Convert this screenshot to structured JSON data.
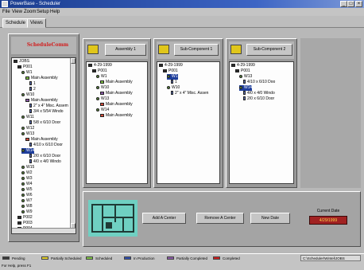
{
  "window": {
    "title": "PowerBase - Scheduler",
    "controls": [
      "_",
      "□",
      "×"
    ],
    "menu": [
      "File",
      "View",
      "Zoom",
      "Setup",
      "Help"
    ]
  },
  "tabs": [
    "Schedule",
    "Views"
  ],
  "panels": {
    "jobs": {
      "logo_text": "ScheduleComm",
      "tree": [
        {
          "text": "JOBS",
          "icon": "folder-icon"
        },
        {
          "text": "P001",
          "icon": "folder-icon"
        },
        {
          "text": "W1",
          "icon": "gear-icon"
        },
        {
          "text": "Main Assembly",
          "icon": "tag-green-icon"
        },
        {
          "text": "1",
          "icon": "doc-icon"
        },
        {
          "text": "2",
          "icon": "doc-icon"
        },
        {
          "text": "W10",
          "icon": "gear-icon"
        },
        {
          "text": "Main Assembly",
          "icon": "tag-purple-icon"
        },
        {
          "text": "2\" x 4\" Misc. Assem",
          "icon": "doc-icon"
        },
        {
          "text": "3/4 x 5/54 Windo",
          "icon": "doc-icon"
        },
        {
          "text": "W11",
          "icon": "gear-icon"
        },
        {
          "text": "5/8 x 6/10 Door",
          "icon": "doc-icon"
        },
        {
          "text": "W12",
          "icon": "gear-icon"
        },
        {
          "text": "W13",
          "icon": "gear-icon"
        },
        {
          "text": "Main Assembly",
          "icon": "tag-red-icon"
        },
        {
          "text": "4/10 x 6/10 Door",
          "icon": "doc-icon"
        },
        {
          "text": "W14",
          "icon": "gear-icon",
          "selected": true
        },
        {
          "text": "2/0 x 6/10 Door",
          "icon": "doc-icon"
        },
        {
          "text": "4/0 x 4/0 Windo",
          "icon": "doc-icon"
        },
        {
          "text": "W15",
          "icon": "gear-icon"
        },
        {
          "text": "W2",
          "icon": "gear-icon"
        },
        {
          "text": "W3",
          "icon": "gear-icon"
        },
        {
          "text": "W4",
          "icon": "gear-icon"
        },
        {
          "text": "W5",
          "icon": "gear-icon"
        },
        {
          "text": "W6",
          "icon": "gear-icon"
        },
        {
          "text": "W7",
          "icon": "gear-icon"
        },
        {
          "text": "W8",
          "icon": "gear-icon"
        },
        {
          "text": "W9",
          "icon": "gear-icon"
        },
        {
          "text": "P002",
          "icon": "folder-icon"
        },
        {
          "text": "P003",
          "icon": "folder-icon"
        },
        {
          "text": "P004",
          "icon": "folder-icon"
        }
      ]
    },
    "assembly": {
      "button_label": "Assembly 1",
      "tree": [
        {
          "text": "4-29-1999",
          "icon": "folder-icon"
        },
        {
          "text": "P001",
          "icon": "folder-icon"
        },
        {
          "text": "W1",
          "icon": "gear-icon"
        },
        {
          "text": "Main Assembly",
          "icon": "tag-green-icon"
        },
        {
          "text": "W10",
          "icon": "gear-icon"
        },
        {
          "text": "Main Assembly",
          "icon": "tag-purple-icon"
        },
        {
          "text": "W13",
          "icon": "gear-icon"
        },
        {
          "text": "Main Assembly",
          "icon": "tag-red-icon"
        },
        {
          "text": "W14",
          "icon": "gear-icon"
        },
        {
          "text": "Main Assembly",
          "icon": "tag-red-icon"
        }
      ]
    },
    "sub1": {
      "button_label": "Sub-Component 1",
      "tree": [
        {
          "text": "4-29-1999",
          "icon": "folder-icon"
        },
        {
          "text": "P001",
          "icon": "folder-icon"
        },
        {
          "text": "W1",
          "icon": "gear-icon",
          "selected": true
        },
        {
          "text": "1",
          "icon": "doc-icon"
        },
        {
          "text": "W10",
          "icon": "gear-icon"
        },
        {
          "text": "2\" x 4\" Misc. Assen",
          "icon": "doc-icon"
        }
      ]
    },
    "sub2": {
      "button_label": "Sub-Component 2",
      "tree": [
        {
          "text": "4-29-1999",
          "icon": "folder-icon"
        },
        {
          "text": "P001",
          "icon": "folder-icon"
        },
        {
          "text": "W13",
          "icon": "gear-icon"
        },
        {
          "text": "4/10 x 6/10 Doo",
          "icon": "doc-icon"
        },
        {
          "text": "W14",
          "icon": "gear-icon",
          "selected": true
        },
        {
          "text": "4/0 x 4/0 Windo",
          "icon": "doc-icon"
        },
        {
          "text": "2/0 x 6/10 Door",
          "icon": "doc-icon"
        }
      ]
    }
  },
  "actions": {
    "add": "Add A Center",
    "remove": "Remove A Center",
    "new_date": "New Date",
    "current_date_label": "Current Date",
    "current_date_value": "4/29/1999"
  },
  "legend": [
    {
      "label": "Pending",
      "color": "#3a3a3a"
    },
    {
      "label": "Partially Scheduled",
      "color": "#e6d229"
    },
    {
      "label": "Scheduled",
      "color": "#7ec244"
    },
    {
      "label": "In Production",
      "color": "#2f4fb0"
    },
    {
      "label": "Partially Completed",
      "color": "#8a5aa7"
    },
    {
      "label": "Completed",
      "color": "#d21d1d"
    }
  ],
  "status": {
    "path": "C:\\Scheduler\\Wintel\\JOBS",
    "help": "For Help, press F1"
  }
}
